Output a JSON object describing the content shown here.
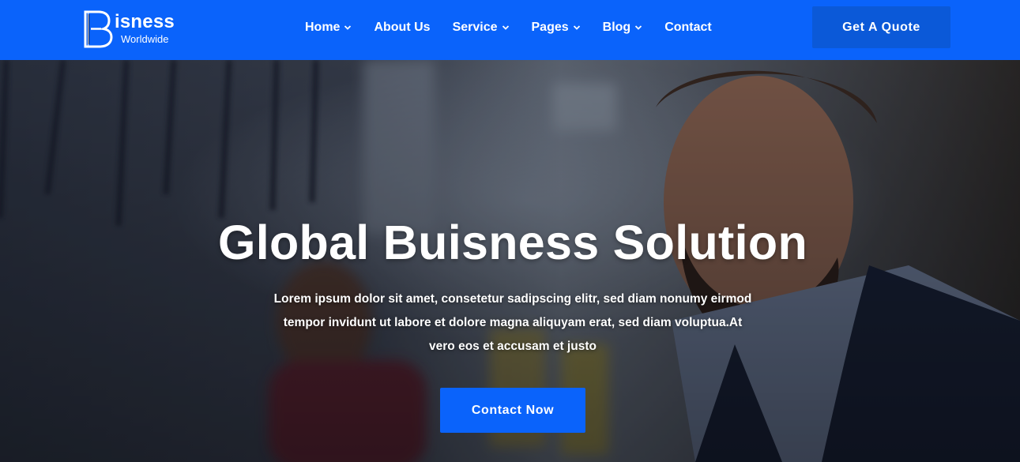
{
  "brand": {
    "name": "isness",
    "tagline": "Worldwide",
    "primary_color": "#0a63fb",
    "button_color": "#0b59d8"
  },
  "nav": {
    "items": [
      {
        "label": "Home",
        "dropdown": true
      },
      {
        "label": "About Us",
        "dropdown": false
      },
      {
        "label": "Service",
        "dropdown": true
      },
      {
        "label": "Pages",
        "dropdown": true
      },
      {
        "label": "Blog",
        "dropdown": true
      },
      {
        "label": "Contact",
        "dropdown": false
      }
    ],
    "cta_label": "Get A Quote"
  },
  "hero": {
    "title": "Global Buisness Solution",
    "description": "Lorem ipsum dolor sit amet, consetetur sadipscing elitr, sed diam nonumy eirmod tempor invidunt ut labore et dolore magna aliquyam erat, sed diam voluptua.At vero eos et accusam et justo",
    "cta_label": "Contact Now"
  }
}
